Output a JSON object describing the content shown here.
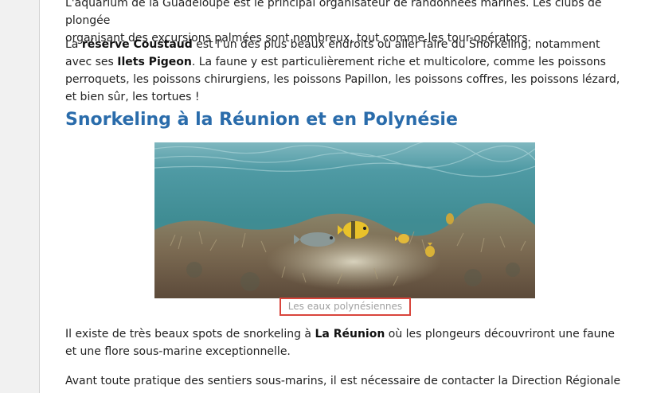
{
  "article": {
    "p_top": {
      "line1": "L'aquarium de la Guadeloupe est le principal organisateur de randonnées marines. Les clubs de plongée",
      "line2": "organisant des excursions palmées sont nombreux, tout comme les tour-opérators."
    },
    "p_coustaud": {
      "t1": "La ",
      "b1": "réserve Coustaud",
      "t2": " est l'un des plus beaux endroits où aller faire du Snorkeling, notamment avec ses ",
      "b2": "Ilets Pigeon",
      "t3": ". La faune y est particulièrement riche et multicolore, comme les poissons perroquets, les poissons chirurgiens, les poissons Papillon, les poissons coffres, les poissons lézard, et bien sûr, les tortues !"
    },
    "heading": "Snorkeling à la Réunion et en Polynésie",
    "figure": {
      "image_name": "underwater-reef-fish-photo",
      "caption": "Les eaux polynésiennes"
    },
    "p_reunion": {
      "t1": "Il existe de très beaux spots de snorkeling à ",
      "b1": "La Réunion",
      "t2": " où les plongeurs découvriront une faune et une flore sous-marine exceptionnelle."
    },
    "p_last": {
      "t1": "Avant toute pratique des sentiers sous-marins, il est nécessaire de contacter la Direction Régionale de"
    }
  },
  "colors": {
    "heading": "#2a6cab",
    "caption_border": "#d9453c",
    "caption_text": "#a0a0a0",
    "body_text": "#222222"
  }
}
